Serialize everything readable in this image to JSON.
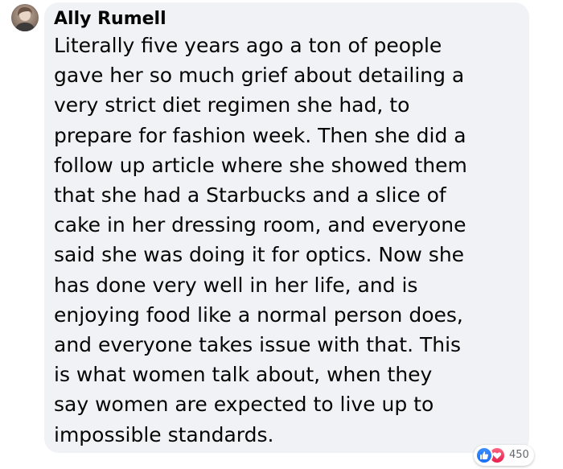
{
  "comment": {
    "author": "Ally Rumell",
    "text": "Literally five years ago a ton of people\ngave her so much grief about detailing a\nvery strict diet regimen she had, to\nprepare for fashion week. Then she did a\nfollow up article where she showed them\nthat she had a Starbucks and a slice of\ncake in her dressing room, and everyone\nsaid she was doing it for optics. Now she\nhas done very well in her life, and is\nenjoying food like a normal person does,\nand everyone takes issue with that. This\nis what women talk about, when they\nsay women are expected to live up to\nimpossible standards.",
    "avatar_icon": "profile-photo",
    "reactions": {
      "icons": [
        "like-icon",
        "love-icon"
      ],
      "count": "450"
    }
  },
  "colors": {
    "bubble_bg": "#f0f2f5",
    "text": "#050505",
    "meta": "#65676b",
    "like": "#1b6ef3",
    "love": "#e61e4d"
  }
}
